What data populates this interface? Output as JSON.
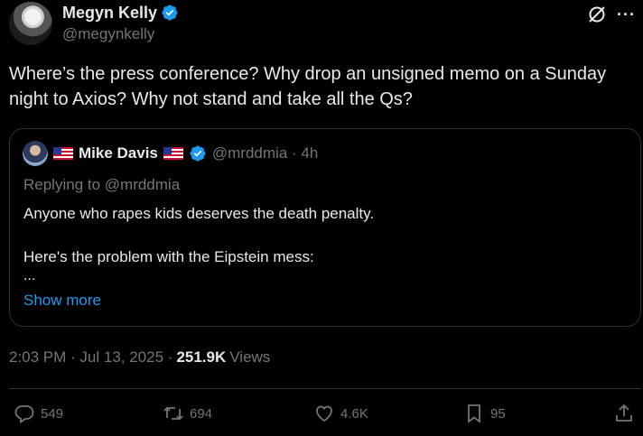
{
  "author": {
    "name": "Megyn Kelly",
    "handle": "@megynkelly"
  },
  "tweet": {
    "text": "Where’s the press conference? Why drop an unsigned memo on a Sunday night to Axios? Why not stand and take all the Qs?"
  },
  "quote": {
    "name": "Mike Davis",
    "handle_time": "@mrddmia · 4h",
    "replying_to": "Replying to @mrddmia",
    "line1": "Anyone who rapes kids deserves the death penalty.",
    "line2": "Here's the problem with the Eipstein mess:",
    "ellipsis": "...",
    "show_more": "Show more"
  },
  "meta": {
    "timestamp": "2:03 PM · Jul 13, 2025 ·",
    "views_count": "251.9K",
    "views_label": "Views"
  },
  "actions": {
    "replies": "549",
    "reposts": "694",
    "likes": "4.6K",
    "bookmarks": "95"
  },
  "colors": {
    "background": "#000000",
    "text": "#e7e9ea",
    "muted": "#71767b",
    "accent": "#1d9bf0",
    "border": "#2f3336"
  },
  "icons": [
    "verified-badge-icon",
    "grok-icon",
    "more-icon",
    "us-flag-icon",
    "reply-icon",
    "repost-icon",
    "like-icon",
    "bookmark-icon",
    "share-icon"
  ]
}
